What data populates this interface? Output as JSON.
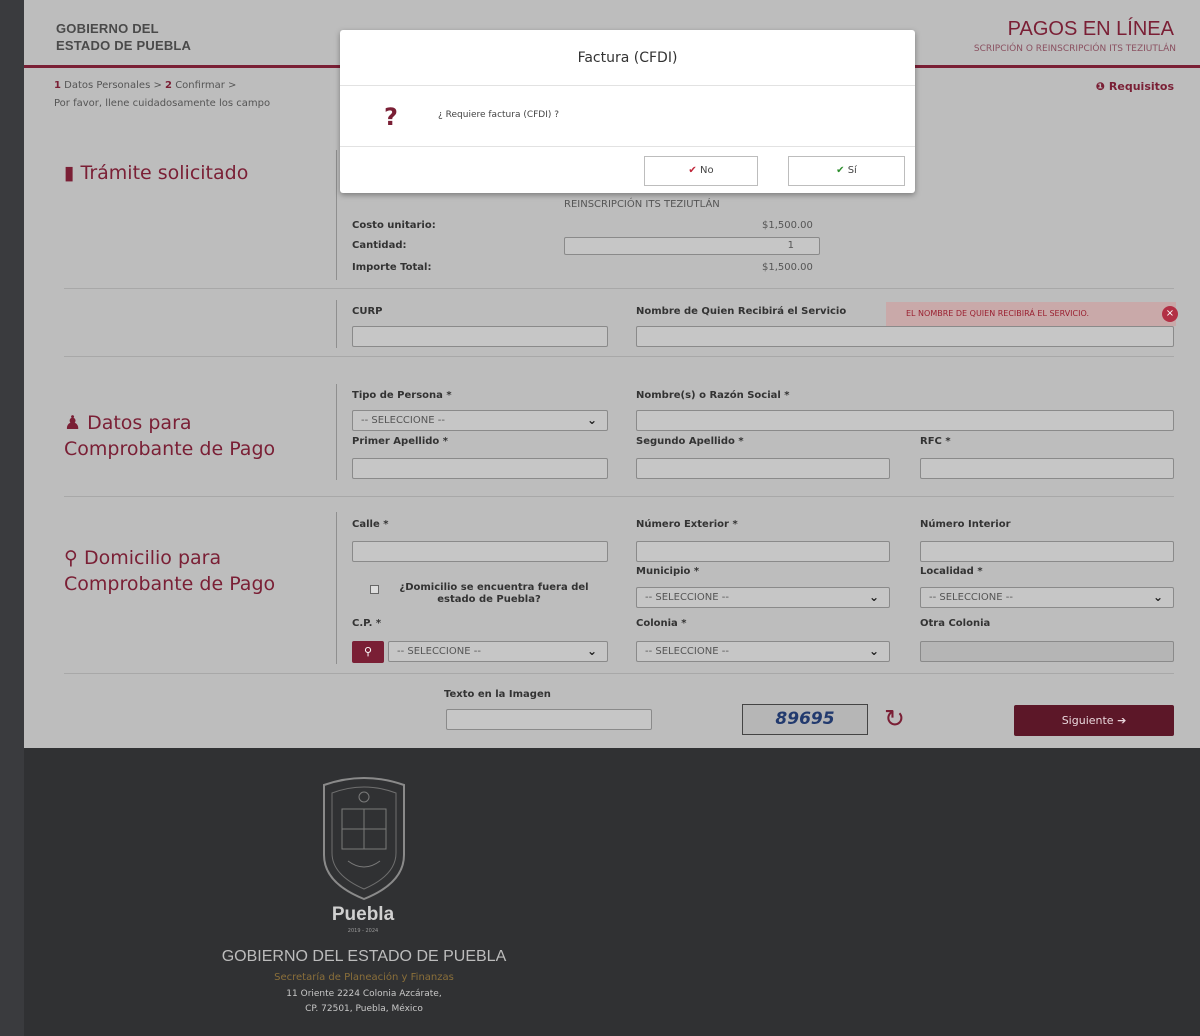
{
  "header": {
    "gov_line1": "GOBIERNO DEL",
    "gov_line2": "ESTADO DE PUEBLA",
    "app_title": "PAGOS EN LÍNEA",
    "service_name": "SCRIPCIÓN O REINSCRIPCIÓN ITS TEZIUTLÁN"
  },
  "steps": {
    "s1_num": "1",
    "s1_label": "Datos Personales",
    "s2_num": "2",
    "s2_label": "Confirmar",
    "requisitos": "Requisitos",
    "instructions": "Por favor, llene cuidadosamente los campo"
  },
  "tramite": {
    "title": "Trámite solicitado",
    "service_value": "REINSCRIPCIÓN ITS TEZIUTLÁN",
    "costo_label": "Costo unitario:",
    "costo_value": "$1,500.00",
    "cantidad_label": "Cantidad:",
    "cantidad_value": "1",
    "importe_label": "Importe Total:",
    "importe_value": "$1,500.00"
  },
  "beneficiario": {
    "curp_label": "CURP",
    "nombre_label": "Nombre de Quien Recibirá el Servicio",
    "error_text": "EL NOMBRE DE QUIEN RECIBIRÁ EL SERVICIO."
  },
  "comprobante": {
    "title_line1": "Datos para",
    "title_line2": "Comprobante de Pago",
    "tipo_label": "Tipo de Persona *",
    "tipo_value": "-- SELECCIONE --",
    "nombre_label": "Nombre(s) o Razón Social *",
    "primer_label": "Primer Apellido *",
    "segundo_label": "Segundo Apellido *",
    "rfc_label": "RFC *"
  },
  "domicilio": {
    "title_line1": "Domicilio para",
    "title_line2": "Comprobante de Pago",
    "calle_label": "Calle *",
    "num_ext_label": "Número Exterior *",
    "num_int_label": "Número Interior",
    "fuera_line1": "¿Domicilio se encuentra fuera del",
    "fuera_line2": "estado de Puebla?",
    "municipio_label": "Municipio *",
    "municipio_value": "-- SELECCIONE --",
    "localidad_label": "Localidad *",
    "localidad_value": "-- SELECCIONE --",
    "cp_label": "C.P. *",
    "cp_value": "-- SELECCIONE --",
    "colonia_label": "Colonia *",
    "colonia_value": "-- SELECCIONE --",
    "otra_label": "Otra Colonia"
  },
  "captcha": {
    "label": "Texto en la Imagen",
    "code": "89695",
    "next_label": "Siguiente"
  },
  "footer": {
    "brand": "Puebla",
    "years": "2019 - 2024",
    "gov": "GOBIERNO DEL ESTADO DE PUEBLA",
    "secretaria": "Secretaría de Planeación y Finanzas",
    "address1": "11 Oriente 2224 Colonia Azcárate,",
    "address2": "CP. 72501, Puebla, México"
  },
  "modal": {
    "title": "Factura (CFDI)",
    "question": "¿ Requiere factura (CFDI) ?",
    "no_label": "No",
    "si_label": "Sí"
  },
  "colors": {
    "accent": "#7a1f35",
    "overlay": "#bdbdbd",
    "footer": "#303133"
  }
}
